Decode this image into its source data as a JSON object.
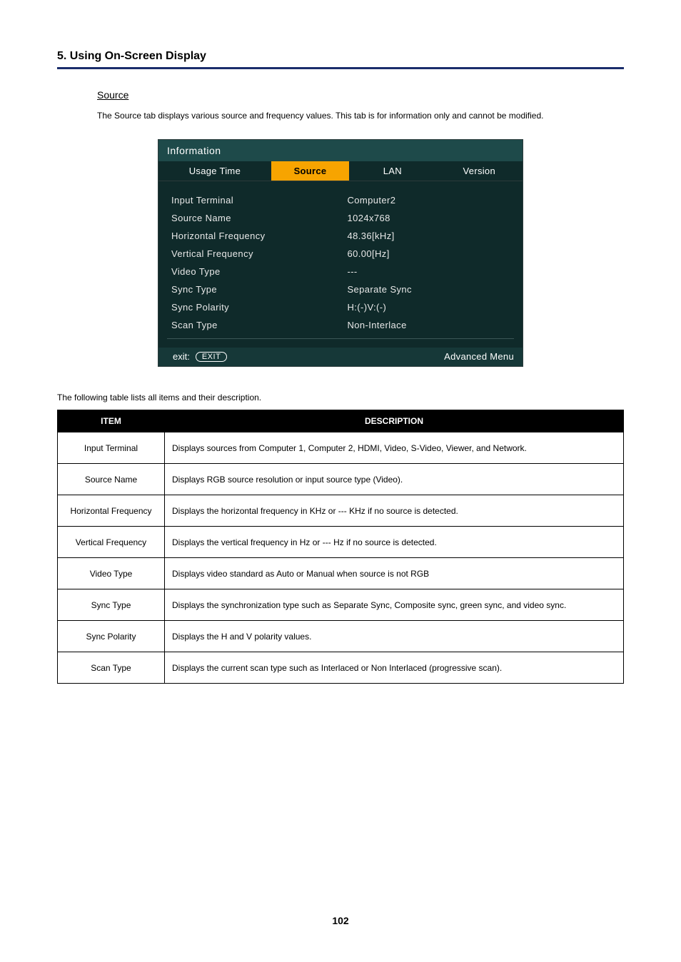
{
  "header": {
    "section_title": "5. Using On-Screen Display"
  },
  "source": {
    "heading": "Source",
    "desc": "The Source tab displays various source and frequency values. This tab is for information only and cannot be modified."
  },
  "osd": {
    "title": "Information",
    "tabs": {
      "usage_time": "Usage Time",
      "source": "Source",
      "lan": "LAN",
      "version": "Version"
    },
    "rows": [
      {
        "label": "Input Terminal",
        "value": "Computer2"
      },
      {
        "label": "Source Name",
        "value": "1024x768"
      },
      {
        "label": "Horizontal Frequency",
        "value": "48.36[kHz]"
      },
      {
        "label": "Vertical Frequency",
        "value": "60.00[Hz]"
      },
      {
        "label": "Video Type",
        "value": "---"
      },
      {
        "label": "Sync Type",
        "value": "Separate Sync"
      },
      {
        "label": "Sync Polarity",
        "value": "H:(-)V:(-)"
      },
      {
        "label": "Scan Type",
        "value": "Non-Interlace"
      }
    ],
    "footer": {
      "exit_label": "exit:",
      "exit_pill": "EXIT",
      "advanced": "Advanced Menu"
    }
  },
  "table": {
    "intro": "The following table lists all items and their description.",
    "head": {
      "item": "ITEM",
      "desc": "DESCRIPTION"
    },
    "rows": [
      {
        "item": "Input Terminal",
        "desc": "Displays sources from Computer 1, Computer 2, HDMI, Video, S-Video, Viewer, and Network."
      },
      {
        "item": "Source Name",
        "desc": "Displays RGB source resolution or input source type (Video)."
      },
      {
        "item": "Horizontal Frequency",
        "desc": "Displays the horizontal frequency in KHz or --- KHz if no source is detected."
      },
      {
        "item": "Vertical Frequency",
        "desc": "Displays the vertical frequency in Hz or --- Hz if no source is detected."
      },
      {
        "item": "Video Type",
        "desc": "Displays video standard as Auto or Manual when source is not RGB"
      },
      {
        "item": "Sync Type",
        "desc": "Displays the synchronization type such as Separate Sync, Composite sync, green sync, and video sync."
      },
      {
        "item": "Sync Polarity",
        "desc": "Displays the H and V polarity values."
      },
      {
        "item": "Scan Type",
        "desc": "Displays the current scan type such as Interlaced or Non Interlaced (progressive scan)."
      }
    ]
  },
  "page_number": "102"
}
